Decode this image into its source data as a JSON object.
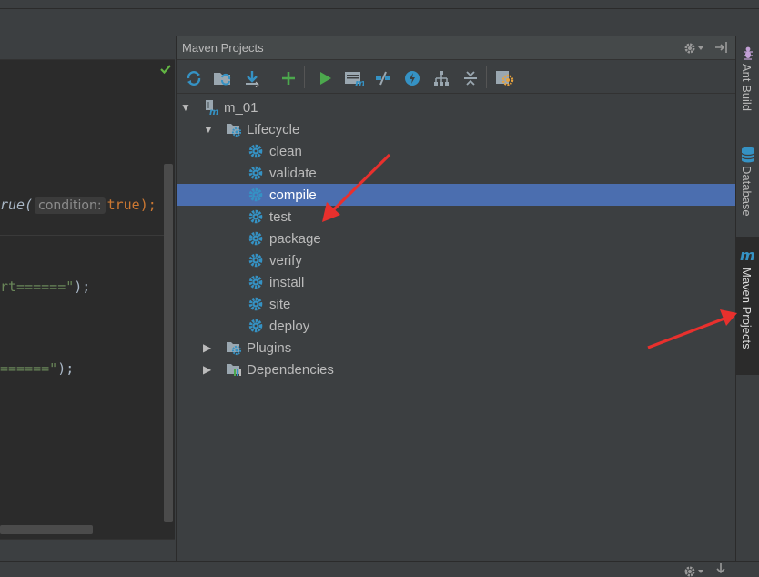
{
  "editor": {
    "line1": {
      "fn": "rue(",
      "hint": "condition:",
      "value": "true",
      "tail": ");"
    },
    "line2": {
      "str": "rt======\"",
      "tail": ");"
    },
    "line3": {
      "str": "======\"",
      "tail": ");"
    }
  },
  "panel": {
    "title": "Maven Projects",
    "toolbar_icons": [
      "refresh-icon",
      "generate-sources-icon",
      "download-icon",
      "add-icon",
      "run-icon",
      "execute-goal-icon",
      "toggle-offline-icon",
      "skip-tests-icon",
      "show-dependencies-icon",
      "collapse-all-icon",
      "settings-icon"
    ]
  },
  "tree": {
    "project": "m_01",
    "lifecycle": "Lifecycle",
    "goals": [
      "clean",
      "validate",
      "compile",
      "test",
      "package",
      "verify",
      "install",
      "site",
      "deploy"
    ],
    "selected_goal": "compile",
    "plugins": "Plugins",
    "dependencies": "Dependencies"
  },
  "side_tabs": {
    "ant": "Ant Build",
    "database": "Database",
    "maven": "Maven Projects"
  },
  "colors": {
    "background": "#3c3f41",
    "editor_bg": "#2b2b2b",
    "selection": "#4b6eaf",
    "accent_blue": "#3592c4",
    "annotation_red": "#e8302d"
  }
}
